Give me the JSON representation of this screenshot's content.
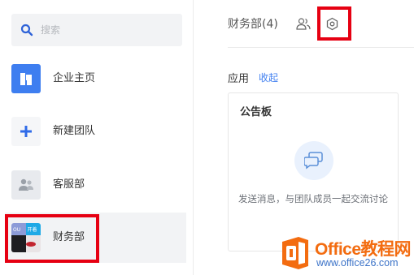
{
  "sidebar": {
    "search": {
      "placeholder": "搜索",
      "value": ""
    },
    "items": [
      {
        "label": "企业主页",
        "icon": "building-icon"
      },
      {
        "label": "新建团队",
        "icon": "plus-icon"
      },
      {
        "label": "客服部",
        "icon": "group-icon"
      },
      {
        "label": "财务部",
        "icon": "team-avatar",
        "avatar_badges": [
          "OU",
          "开着"
        ],
        "selected": true
      }
    ]
  },
  "main": {
    "title": "财务部(4)",
    "apps_label": "应用",
    "collapse_label": "收起",
    "card": {
      "title": "公告板",
      "message": "发送消息，与团队成员一起交流讨论"
    }
  },
  "watermark": {
    "title": "Office教程网",
    "url": "www.office26.com"
  },
  "colors": {
    "accent": "#3e7ef0",
    "highlight": "#e60012",
    "watermark_orange": "#f36c10",
    "selected_bg": "#f2f3f5"
  }
}
